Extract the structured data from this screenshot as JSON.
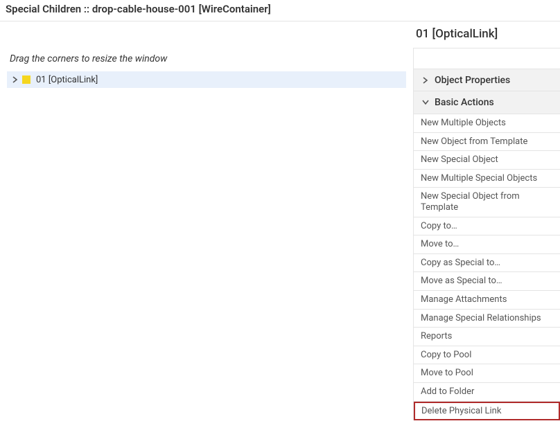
{
  "header": {
    "title": "Special Children :: drop-cable-house-001 [WireContainer]"
  },
  "left": {
    "hint": "Drag the corners to resize the window",
    "tree": {
      "item_label": "01 [OpticalLink]"
    }
  },
  "right": {
    "title": "01 [OpticalLink]",
    "sections": {
      "properties_label": "Object Properties",
      "basic_actions_label": "Basic Actions"
    },
    "actions": [
      "New Multiple Objects",
      "New Object from Template",
      "New Special Object",
      "New Multiple Special Objects",
      "New Special Object from Template",
      "Copy to…",
      "Move to…",
      "Copy as Special to…",
      "Move as Special to…",
      "Manage Attachments",
      "Manage Special Relationships",
      "Reports",
      "Copy to Pool",
      "Move to Pool",
      "Add to Folder",
      "Delete Physical Link"
    ],
    "highlight_index": 15
  }
}
